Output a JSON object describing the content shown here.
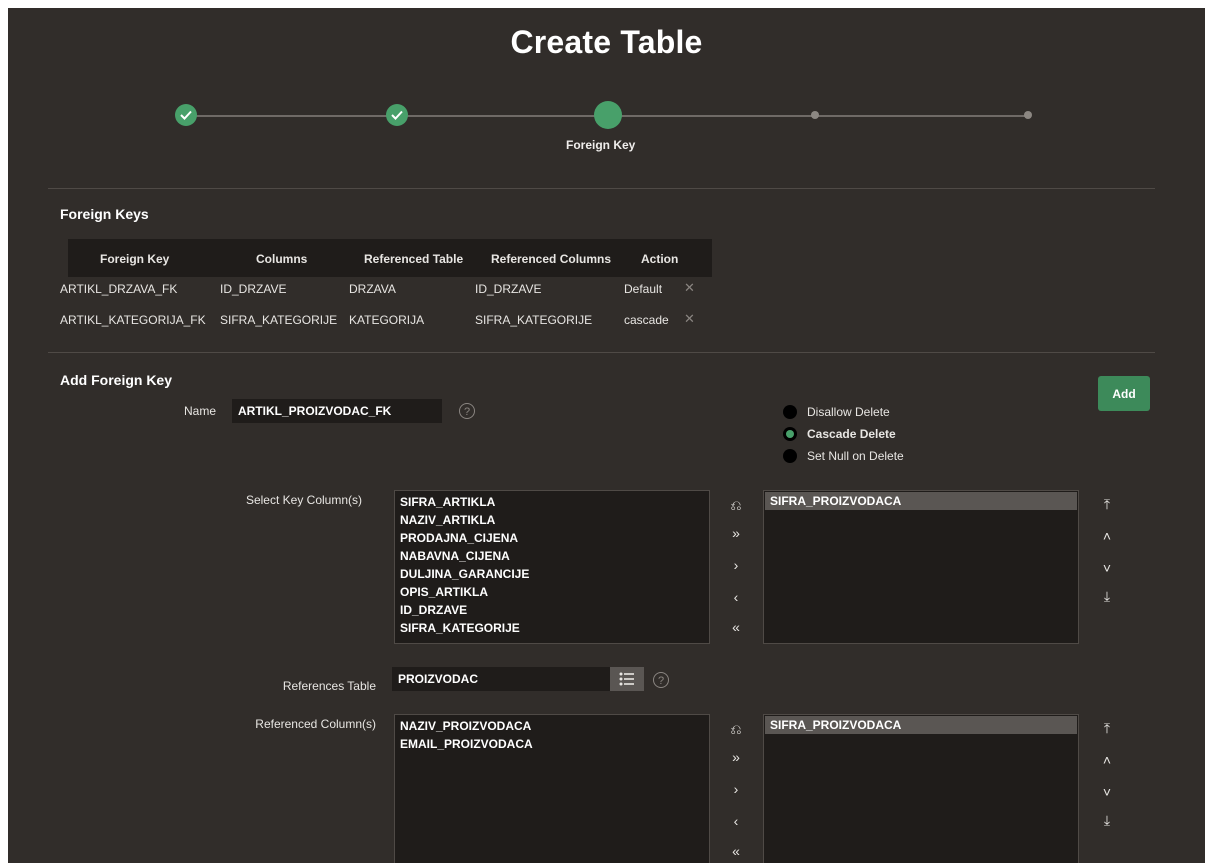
{
  "page": {
    "title": "Create Table"
  },
  "wizard": {
    "current_step_label": "Foreign Key"
  },
  "foreign_keys": {
    "section_title": "Foreign Keys",
    "headers": [
      "Foreign Key",
      "Columns",
      "Referenced Table",
      "Referenced Columns",
      "Action"
    ],
    "rows": [
      {
        "name": "ARTIKL_DRZAVA_FK",
        "columns": "ID_DRZAVE",
        "ref_table": "DRZAVA",
        "ref_columns": "ID_DRZAVE",
        "action": "Default"
      },
      {
        "name": "ARTIKL_KATEGORIJA_FK",
        "columns": "SIFRA_KATEGORIJE",
        "ref_table": "KATEGORIJA",
        "ref_columns": "SIFRA_KATEGORIJE",
        "action": "cascade"
      }
    ]
  },
  "add_fk": {
    "section_title": "Add Foreign Key",
    "add_button": "Add",
    "name_label": "Name",
    "name_value": "ARTIKL_PROIZVODAC_FK",
    "delete_options": [
      {
        "label": "Disallow Delete",
        "selected": false
      },
      {
        "label": "Cascade Delete",
        "selected": true
      },
      {
        "label": "Set Null on Delete",
        "selected": false
      }
    ],
    "key_columns_label": "Select Key Column(s)",
    "key_columns_available": [
      "SIFRA_ARTIKLA",
      "NAZIV_ARTIKLA",
      "PRODAJNA_CIJENA",
      "NABAVNA_CIJENA",
      "DULJINA_GARANCIJE",
      "OPIS_ARTIKLA",
      "ID_DRZAVE",
      "SIFRA_KATEGORIJE"
    ],
    "key_columns_selected": [
      "SIFRA_PROIZVODACA"
    ],
    "ref_table_label": "References Table",
    "ref_table_value": "PROIZVODAC",
    "ref_columns_label": "Referenced Column(s)",
    "ref_columns_available": [
      "NAZIV_PROIZVODACA",
      "EMAIL_PROIZVODACA"
    ],
    "ref_columns_selected": [
      "SIFRA_PROIZVODACA"
    ]
  },
  "colors": {
    "accent": "#48a06a",
    "background": "#312d2a",
    "field": "#1f1c1a"
  }
}
